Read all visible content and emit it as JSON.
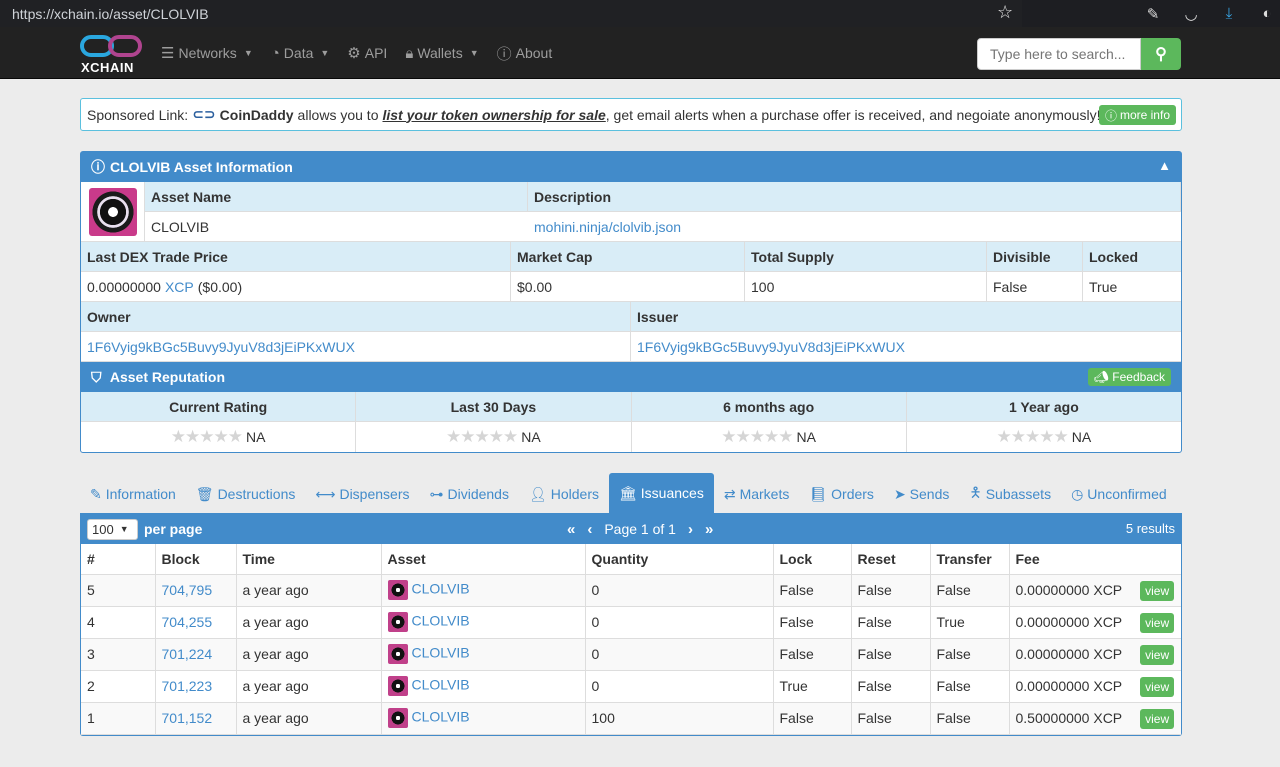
{
  "browser": {
    "url": "https://xchain.io/asset/CLOLVIB"
  },
  "navbar": {
    "logo_text": "XCHAIN",
    "items": [
      {
        "label": "Networks",
        "icon": "database-icon",
        "dropdown": true
      },
      {
        "label": "Data",
        "icon": "dashboard-icon",
        "dropdown": true
      },
      {
        "label": "API",
        "icon": "cogs-icon",
        "dropdown": false
      },
      {
        "label": "Wallets",
        "icon": "lock-icon",
        "dropdown": true
      },
      {
        "label": "About",
        "icon": "info-icon",
        "dropdown": false
      }
    ],
    "search_placeholder": "Type here to search..."
  },
  "sponsor": {
    "prefix": "Sponsored Link:",
    "brand": "CoinDaddy",
    "text1": "allows you to",
    "link": "list your token ownership for sale",
    "text2": ", get email alerts when a purchase offer is received, and negoiate anonymously!",
    "more": "more info"
  },
  "asset_info": {
    "title": "CLOLVIB Asset Information",
    "asset_name_label": "Asset Name",
    "asset_name": "CLOLVIB",
    "description_label": "Description",
    "description": "mohini.ninja/clolvib.json",
    "price_label": "Last DEX Trade Price",
    "price_value": "0.00000000",
    "price_unit": "XCP",
    "price_usd": "($0.00)",
    "market_cap_label": "Market Cap",
    "market_cap": "$0.00",
    "supply_label": "Total Supply",
    "supply": "100",
    "divisible_label": "Divisible",
    "divisible": "False",
    "locked_label": "Locked",
    "locked": "True",
    "owner_label": "Owner",
    "owner": "1F6Vyig9kBGc5Buvy9JyuV8d3jEiPKxWUX",
    "issuer_label": "Issuer",
    "issuer": "1F6Vyig9kBGc5Buvy9JyuV8d3jEiPKxWUX"
  },
  "reputation": {
    "title": "Asset Reputation",
    "feedback": "Feedback",
    "columns": [
      {
        "label": "Current Rating",
        "value": "NA"
      },
      {
        "label": "Last 30 Days",
        "value": "NA"
      },
      {
        "label": "6 months ago",
        "value": "NA"
      },
      {
        "label": "1 Year ago",
        "value": "NA"
      }
    ]
  },
  "tabs": [
    {
      "label": "Information",
      "icon": "pencil-icon"
    },
    {
      "label": "Destructions",
      "icon": "trash-icon"
    },
    {
      "label": "Dispensers",
      "icon": "arrows-h-icon"
    },
    {
      "label": "Dividends",
      "icon": "sitemap-icon"
    },
    {
      "label": "Holders",
      "icon": "user-icon"
    },
    {
      "label": "Issuances",
      "icon": "bank-icon",
      "active": true
    },
    {
      "label": "Markets",
      "icon": "exchange-icon"
    },
    {
      "label": "Orders",
      "icon": "book-icon"
    },
    {
      "label": "Sends",
      "icon": "paper-plane-icon"
    },
    {
      "label": "Subassets",
      "icon": "child-icon"
    },
    {
      "label": "Unconfirmed",
      "icon": "clock-icon"
    }
  ],
  "issuances": {
    "per_page_value": "100",
    "per_page_label": "per page",
    "page_text": "Page 1 of 1",
    "results": "5 results",
    "columns": [
      "#",
      "Block",
      "Time",
      "Asset",
      "Quantity",
      "Lock",
      "Reset",
      "Transfer",
      "Fee",
      ""
    ],
    "rows": [
      {
        "n": "5",
        "block": "704,795",
        "time": "a year ago",
        "asset": "CLOLVIB",
        "quantity": "0",
        "lock": "False",
        "reset": "False",
        "transfer": "False",
        "fee": "0.00000000 XCP"
      },
      {
        "n": "4",
        "block": "704,255",
        "time": "a year ago",
        "asset": "CLOLVIB",
        "quantity": "0",
        "lock": "False",
        "reset": "False",
        "transfer": "True",
        "fee": "0.00000000 XCP"
      },
      {
        "n": "3",
        "block": "701,224",
        "time": "a year ago",
        "asset": "CLOLVIB",
        "quantity": "0",
        "lock": "False",
        "reset": "False",
        "transfer": "False",
        "fee": "0.00000000 XCP"
      },
      {
        "n": "2",
        "block": "701,223",
        "time": "a year ago",
        "asset": "CLOLVIB",
        "quantity": "0",
        "lock": "True",
        "reset": "False",
        "transfer": "False",
        "fee": "0.00000000 XCP"
      },
      {
        "n": "1",
        "block": "701,152",
        "time": "a year ago",
        "asset": "CLOLVIB",
        "quantity": "100",
        "lock": "False",
        "reset": "False",
        "transfer": "False",
        "fee": "0.50000000 XCP"
      }
    ],
    "view_label": "view"
  }
}
